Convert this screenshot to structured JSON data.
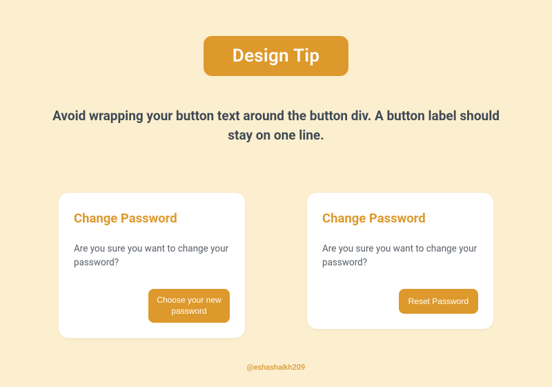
{
  "header": {
    "badge_label": "Design Tip",
    "tip_text": "Avoid wrapping your button text around the button div. A button label should stay on one line."
  },
  "examples": {
    "bad": {
      "title": "Change Password",
      "body": "Are you sure you want to change your password?",
      "button_label": "Choose your new password"
    },
    "good": {
      "title": "Change Password",
      "body": "Are you sure you want to change your password?",
      "button_label": "Reset Password"
    }
  },
  "footer": {
    "credit": "@eshashaikh209"
  },
  "colors": {
    "accent": "#dd992c",
    "background": "#fcefcf",
    "text_dark": "#3f4a55"
  }
}
